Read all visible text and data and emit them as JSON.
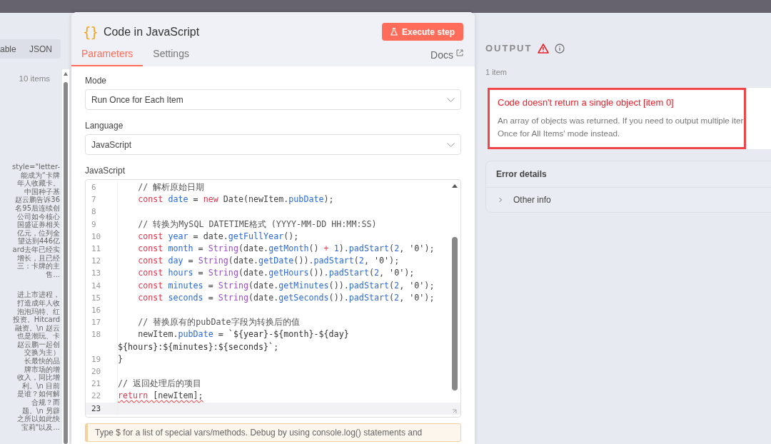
{
  "input_panel": {
    "tabs": [
      {
        "label": "able",
        "selected": false
      },
      {
        "label": "JSON",
        "selected": false
      }
    ],
    "item_count": "10 items",
    "preview_paragraphs": [
      [
        "style=\"letter-",
        "能成为“卡牌",
        "年人收藏卡。",
        "中国种子基",
        "赵云鹏告诉36",
        "名95后连续创",
        "公司如今核心",
        "国盛证券相关",
        "亿元，位列全",
        "望达到446亿",
        "ard去年已经实",
        "增长，且已经",
        "三：卡牌的主",
        "售..."
      ],
      [
        "进上市进程，",
        "打造成年人收",
        "泡泡玛特、红",
        "投资。Hitcard",
        "融资。\\n 赵云",
        "也是潮玩、卡",
        "赵云鹏一起创",
        "交换为主）",
        "长最快的品",
        "牌市场的增",
        "收入，同比增",
        "利。\\n 目前",
        "是谁？如何解",
        "合规？而",
        "题。\\n 另辟",
        "之所以如此快",
        "宝莉\"以及..."
      ]
    ]
  },
  "node": {
    "icon": "{}",
    "title": "Code in JavaScript",
    "execute_button": "Execute step",
    "tabs": [
      {
        "label": "Parameters",
        "selected": true
      },
      {
        "label": "Settings",
        "selected": false
      }
    ],
    "docs_link": "Docs",
    "mode": {
      "label": "Mode",
      "value": "Run Once for Each Item"
    },
    "language": {
      "label": "Language",
      "value": "JavaScript"
    },
    "editor": {
      "label": "JavaScript",
      "lines": [
        {
          "number": "6",
          "active": false,
          "has_error": false,
          "segments": [
            {
              "kind": "comment",
              "text": "    // 解析原始日期"
            }
          ]
        },
        {
          "number": "7",
          "active": false,
          "has_error": false,
          "segments": [
            {
              "kind": "keyword",
              "text": "    const"
            },
            {
              "kind": "variable",
              "text": " date"
            },
            {
              "kind": "plain",
              "text": " = "
            },
            {
              "kind": "keyword",
              "text": "new"
            },
            {
              "kind": "plain",
              "text": " Date(newItem."
            },
            {
              "kind": "variable",
              "text": "pubDate"
            },
            {
              "kind": "plain",
              "text": ");"
            }
          ]
        },
        {
          "number": "8",
          "active": false
        },
        {
          "number": "9",
          "active": false,
          "has_error": false,
          "segments": [
            {
              "kind": "comment",
              "text": "    // 转换为MySQL DATETIME格式 (YYYY-MM-DD HH:MM:SS)"
            }
          ]
        },
        {
          "number": "10",
          "active": false,
          "has_error": false,
          "segments": [
            {
              "kind": "keyword",
              "text": "    const"
            },
            {
              "kind": "variable",
              "text": " year"
            },
            {
              "kind": "plain",
              "text": " = date."
            },
            {
              "kind": "variable",
              "text": "getFullYear"
            },
            {
              "kind": "plain",
              "text": "();"
            }
          ]
        },
        {
          "number": "11",
          "active": false,
          "has_error": false,
          "segments": [
            {
              "kind": "keyword",
              "text": "    const"
            },
            {
              "kind": "variable",
              "text": " month"
            },
            {
              "kind": "plain",
              "text": " = "
            },
            {
              "kind": "type",
              "text": "String"
            },
            {
              "kind": "plain",
              "text": "(date."
            },
            {
              "kind": "variable",
              "text": "getMonth"
            },
            {
              "kind": "plain",
              "text": "() "
            },
            {
              "kind": "keyword",
              "text": "+"
            },
            {
              "kind": "number",
              "text": " 1"
            },
            {
              "kind": "plain",
              "text": ")."
            },
            {
              "kind": "variable",
              "text": "padStart"
            },
            {
              "kind": "plain",
              "text": "("
            },
            {
              "kind": "number",
              "text": "2"
            },
            {
              "kind": "plain",
              "text": ", "
            },
            {
              "kind": "string",
              "text": "'0'"
            },
            {
              "kind": "plain",
              "text": ");"
            }
          ]
        },
        {
          "number": "12",
          "active": false,
          "has_error": false,
          "segments": [
            {
              "kind": "keyword",
              "text": "    const"
            },
            {
              "kind": "variable",
              "text": " day"
            },
            {
              "kind": "plain",
              "text": " = "
            },
            {
              "kind": "type",
              "text": "String"
            },
            {
              "kind": "plain",
              "text": "(date."
            },
            {
              "kind": "variable",
              "text": "getDate"
            },
            {
              "kind": "plain",
              "text": "())."
            },
            {
              "kind": "variable",
              "text": "padStart"
            },
            {
              "kind": "plain",
              "text": "("
            },
            {
              "kind": "number",
              "text": "2"
            },
            {
              "kind": "plain",
              "text": ", "
            },
            {
              "kind": "string",
              "text": "'0'"
            },
            {
              "kind": "plain",
              "text": ");"
            }
          ]
        },
        {
          "number": "13",
          "active": false,
          "has_error": false,
          "segments": [
            {
              "kind": "keyword",
              "text": "    const"
            },
            {
              "kind": "variable",
              "text": " hours"
            },
            {
              "kind": "plain",
              "text": " = "
            },
            {
              "kind": "type",
              "text": "String"
            },
            {
              "kind": "plain",
              "text": "(date."
            },
            {
              "kind": "variable",
              "text": "getHours"
            },
            {
              "kind": "plain",
              "text": "())."
            },
            {
              "kind": "variable",
              "text": "padStart"
            },
            {
              "kind": "plain",
              "text": "("
            },
            {
              "kind": "number",
              "text": "2"
            },
            {
              "kind": "plain",
              "text": ", "
            },
            {
              "kind": "string",
              "text": "'0'"
            },
            {
              "kind": "plain",
              "text": ");"
            }
          ]
        },
        {
          "number": "14",
          "active": false,
          "has_error": false,
          "segments": [
            {
              "kind": "keyword",
              "text": "    const"
            },
            {
              "kind": "variable",
              "text": " minutes"
            },
            {
              "kind": "plain",
              "text": " = "
            },
            {
              "kind": "type",
              "text": "String"
            },
            {
              "kind": "plain",
              "text": "(date."
            },
            {
              "kind": "variable",
              "text": "getMinutes"
            },
            {
              "kind": "plain",
              "text": "())."
            },
            {
              "kind": "variable",
              "text": "padStart"
            },
            {
              "kind": "plain",
              "text": "("
            },
            {
              "kind": "number",
              "text": "2"
            },
            {
              "kind": "plain",
              "text": ", "
            },
            {
              "kind": "string",
              "text": "'0'"
            },
            {
              "kind": "plain",
              "text": ");"
            }
          ]
        },
        {
          "number": "15",
          "active": false,
          "has_error": false,
          "segments": [
            {
              "kind": "keyword",
              "text": "    const"
            },
            {
              "kind": "variable",
              "text": " seconds"
            },
            {
              "kind": "plain",
              "text": " = "
            },
            {
              "kind": "type",
              "text": "String"
            },
            {
              "kind": "plain",
              "text": "(date."
            },
            {
              "kind": "variable",
              "text": "getSeconds"
            },
            {
              "kind": "plain",
              "text": "())."
            },
            {
              "kind": "variable",
              "text": "padStart"
            },
            {
              "kind": "plain",
              "text": "("
            },
            {
              "kind": "number",
              "text": "2"
            },
            {
              "kind": "plain",
              "text": ", "
            },
            {
              "kind": "string",
              "text": "'0'"
            },
            {
              "kind": "plain",
              "text": ");"
            }
          ]
        },
        {
          "number": "16",
          "active": false
        },
        {
          "number": "17",
          "active": false,
          "has_error": false,
          "segments": [
            {
              "kind": "comment",
              "text": "    // 替换原有的pubDate字段为转换后的值"
            }
          ]
        },
        {
          "number": "18",
          "active": false,
          "has_error": false,
          "segments": [
            {
              "kind": "plain",
              "text": "    newItem."
            },
            {
              "kind": "variable",
              "text": "pubDate"
            },
            {
              "kind": "plain",
              "text": " = "
            },
            {
              "kind": "string",
              "text": "`${year}-${month}-${day} ${hours}:${minutes}:${seconds}`"
            },
            {
              "kind": "plain",
              "text": ";"
            }
          ]
        },
        {
          "number": "19",
          "active": false,
          "has_error": false,
          "segments": [
            {
              "kind": "plain",
              "text": "}"
            }
          ]
        },
        {
          "number": "20",
          "active": false
        },
        {
          "number": "21",
          "active": false,
          "has_error": false,
          "segments": [
            {
              "kind": "comment",
              "text": "// 返回处理后的项目"
            }
          ]
        },
        {
          "number": "22",
          "active": false,
          "has_error": true,
          "segments": [
            {
              "kind": "keyword",
              "text": "return"
            },
            {
              "kind": "plain",
              "text": " [newItem];"
            }
          ]
        },
        {
          "number": "23",
          "active": true
        }
      ]
    },
    "hint": "Type $ for a list of special vars/methods. Debug by using console.log() statements and"
  },
  "output_panel": {
    "title": "OUTPUT",
    "item_count": "1 item",
    "error": {
      "title": "Code doesn't return a single object [item 0]",
      "message_lines": [
        "An array of objects was returned. If you need to output multiple iter",
        "Once for All Items' mode instead."
      ],
      "highlighted": true
    },
    "details": {
      "title": "Error details",
      "sections": [
        {
          "label": "Other info",
          "expanded": false
        }
      ]
    }
  }
}
